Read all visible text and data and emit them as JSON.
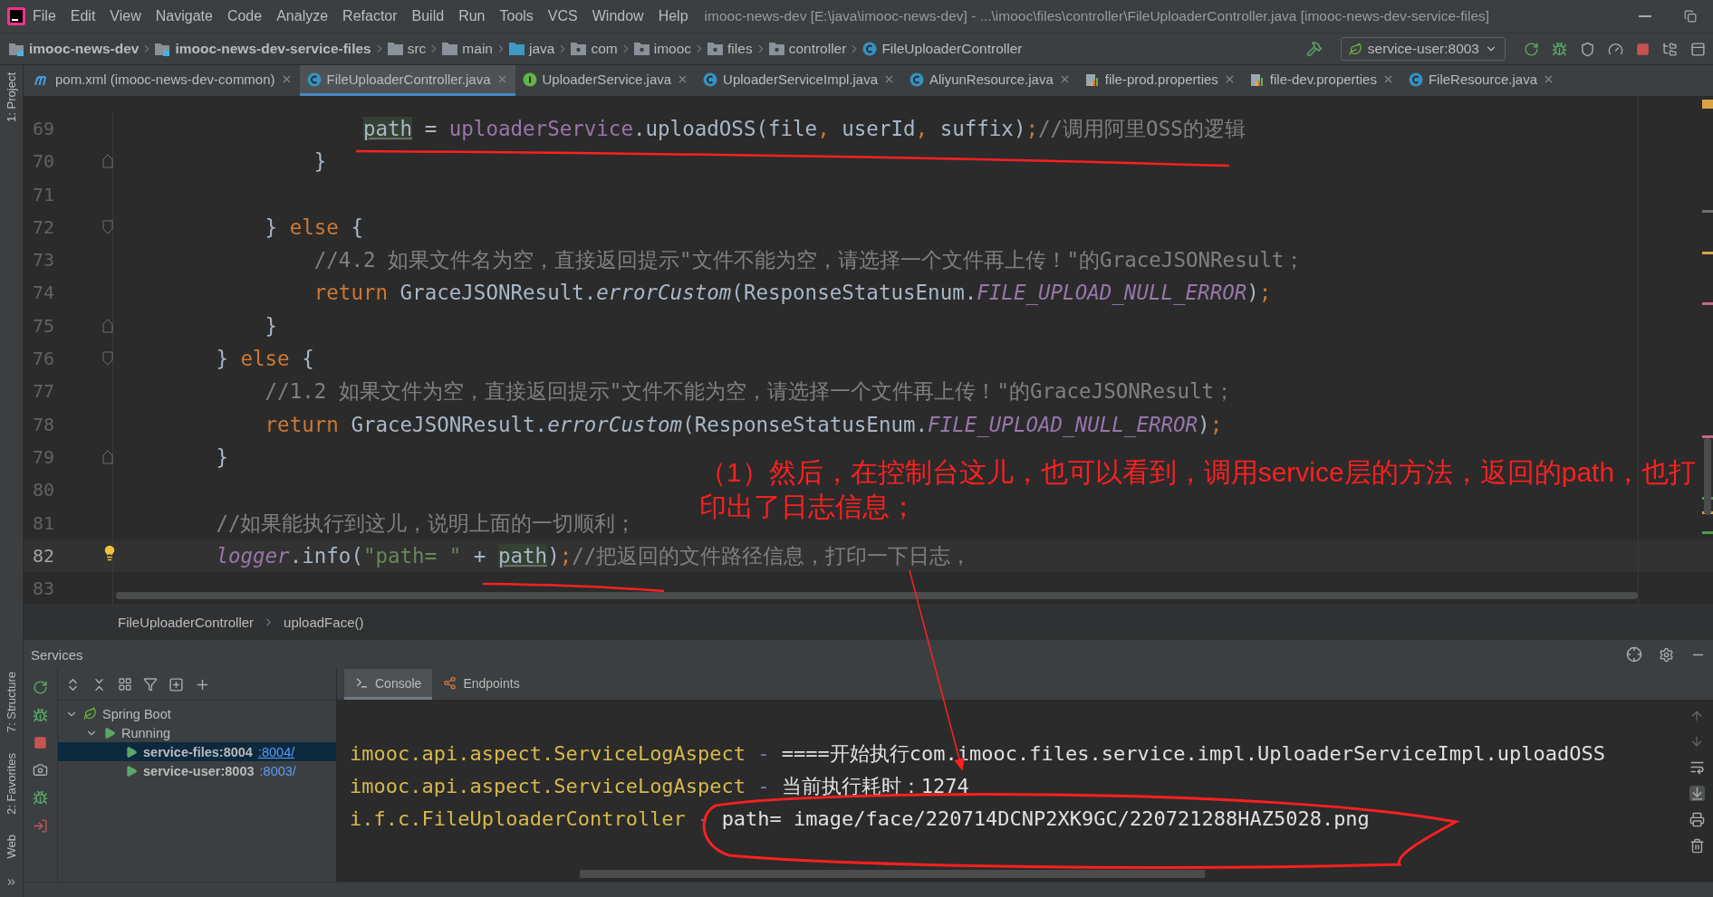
{
  "window": {
    "title": "imooc-news-dev [E:\\java\\imooc-news-dev] - ...\\imooc\\files\\controller\\FileUploaderController.java [imooc-news-dev-service-files]"
  },
  "menu": [
    "File",
    "Edit",
    "View",
    "Navigate",
    "Code",
    "Analyze",
    "Refactor",
    "Build",
    "Run",
    "Tools",
    "VCS",
    "Window",
    "Help"
  ],
  "navigation": [
    {
      "label": "imooc-news-dev",
      "kind": "module"
    },
    {
      "label": "imooc-news-dev-service-files",
      "kind": "module"
    },
    {
      "label": "src",
      "kind": "folder"
    },
    {
      "label": "main",
      "kind": "folder"
    },
    {
      "label": "java",
      "kind": "source"
    },
    {
      "label": "com",
      "kind": "package"
    },
    {
      "label": "imooc",
      "kind": "package"
    },
    {
      "label": "files",
      "kind": "package"
    },
    {
      "label": "controller",
      "kind": "package"
    },
    {
      "label": "FileUploaderController",
      "kind": "class"
    }
  ],
  "run_config": {
    "label": "service-user:8003"
  },
  "tool_strip": [
    {
      "label": "1: Project"
    },
    {
      "label": "7: Structure"
    },
    {
      "label": "2: Favorites"
    },
    {
      "label": "Web"
    }
  ],
  "tabs": [
    {
      "label": "pom.xml (imooc-news-dev-common)",
      "kind": "maven",
      "selected": false
    },
    {
      "label": "FileUploaderController.java",
      "kind": "class",
      "selected": true
    },
    {
      "label": "UploaderService.java",
      "kind": "interface",
      "selected": false
    },
    {
      "label": "UploaderServiceImpl.java",
      "kind": "class",
      "selected": false
    },
    {
      "label": "AliyunResource.java",
      "kind": "class",
      "selected": false
    },
    {
      "label": "file-prod.properties",
      "kind": "properties",
      "selected": false
    },
    {
      "label": "file-dev.properties",
      "kind": "properties",
      "selected": false
    },
    {
      "label": "FileResource.java",
      "kind": "class",
      "selected": false
    }
  ],
  "editor": {
    "lines": [
      {
        "number": "69",
        "current": false,
        "bulb": false,
        "kind": "plain",
        "tokens": [
          {
            "kind": "ref",
            "text": "                    path"
          },
          {
            "kind": "text",
            "text": " = "
          },
          {
            "kind": "field",
            "text": "uploaderService"
          },
          {
            "kind": "text",
            "text": ".uploadOSS(file"
          },
          {
            "kind": "punct",
            "text": ","
          },
          {
            "kind": "text",
            "text": " userId"
          },
          {
            "kind": "punct",
            "text": ","
          },
          {
            "kind": "text",
            "text": " suffix)"
          },
          {
            "kind": "punct",
            "text": ";"
          },
          {
            "kind": "comment",
            "text": "//调用阿里OSS的逻辑"
          }
        ]
      },
      {
        "number": "70",
        "current": false,
        "bulb": false,
        "kind": "fold_end",
        "tokens": [
          {
            "kind": "text",
            "text": "                }"
          }
        ]
      },
      {
        "number": "71",
        "current": false,
        "bulb": false,
        "kind": "plain"
      },
      {
        "number": "72",
        "current": false,
        "bulb": false,
        "kind": "fold_start",
        "tokens": [
          {
            "kind": "text",
            "text": "            } "
          },
          {
            "kind": "keyword",
            "text": "else"
          },
          {
            "kind": "text",
            "text": " {"
          }
        ]
      },
      {
        "number": "73",
        "current": false,
        "bulb": false,
        "kind": "plain",
        "tokens": [
          {
            "kind": "comment",
            "text": "                //4.2 如果文件名为空，直接返回提示\"文件不能为空，请选择一个文件再上传！\"的GraceJSONResult；"
          }
        ]
      },
      {
        "number": "74",
        "current": false,
        "bulb": false,
        "kind": "plain",
        "tokens": [
          {
            "kind": "keyword",
            "text": "                return"
          },
          {
            "kind": "text",
            "text": " GraceJSONResult."
          },
          {
            "kind": "static",
            "text": "errorCustom"
          },
          {
            "kind": "text",
            "text": "(ResponseStatusEnum."
          },
          {
            "kind": "constant",
            "text": "FILE_UPLOAD_NULL_ERROR"
          },
          {
            "kind": "text",
            "text": ")"
          },
          {
            "kind": "punct",
            "text": ";"
          }
        ]
      },
      {
        "number": "75",
        "current": false,
        "bulb": false,
        "kind": "fold_end",
        "tokens": [
          {
            "kind": "text",
            "text": "            }"
          }
        ]
      },
      {
        "number": "76",
        "current": false,
        "bulb": false,
        "kind": "fold_start",
        "tokens": [
          {
            "kind": "text",
            "text": "        } "
          },
          {
            "kind": "keyword",
            "text": "else"
          },
          {
            "kind": "text",
            "text": " {"
          }
        ]
      },
      {
        "number": "77",
        "current": false,
        "bulb": false,
        "kind": "plain",
        "tokens": [
          {
            "kind": "comment",
            "text": "            //1.2 如果文件为空，直接返回提示\"文件不能为空，请选择一个文件再上传！\"的GraceJSONResult；"
          }
        ]
      },
      {
        "number": "78",
        "current": false,
        "bulb": false,
        "kind": "plain",
        "tokens": [
          {
            "kind": "keyword",
            "text": "            return"
          },
          {
            "kind": "text",
            "text": " GraceJSONResult."
          },
          {
            "kind": "static",
            "text": "errorCustom"
          },
          {
            "kind": "text",
            "text": "(ResponseStatusEnum."
          },
          {
            "kind": "constant",
            "text": "FILE_UPLOAD_NULL_ERROR"
          },
          {
            "kind": "text",
            "text": ")"
          },
          {
            "kind": "punct",
            "text": ";"
          }
        ]
      },
      {
        "number": "79",
        "current": false,
        "bulb": false,
        "kind": "fold_end",
        "tokens": [
          {
            "kind": "text",
            "text": "        }"
          }
        ]
      },
      {
        "number": "80",
        "current": false,
        "bulb": false,
        "kind": "plain"
      },
      {
        "number": "81",
        "current": false,
        "bulb": false,
        "kind": "plain",
        "tokens": [
          {
            "kind": "comment",
            "text": "        //如果能执行到这儿，说明上面的一切顺利；"
          }
        ]
      },
      {
        "number": "82",
        "current": true,
        "bulb": true,
        "kind": "plain",
        "tokens": [
          {
            "kind": "logger",
            "text": "        logger"
          },
          {
            "kind": "text",
            "text": ".info("
          },
          {
            "kind": "string",
            "text": "\"path= \""
          },
          {
            "kind": "text",
            "text": " + "
          },
          {
            "kind": "ref",
            "text": "path"
          },
          {
            "kind": "text",
            "text": ")"
          },
          {
            "kind": "punct",
            "text": ";"
          },
          {
            "kind": "comment",
            "text": "//把返回的文件路径信息，打印一下日志，"
          }
        ]
      },
      {
        "number": "83",
        "current": false,
        "bulb": false,
        "kind": "plain"
      }
    ],
    "breadcrumb": [
      "FileUploaderController",
      "uploadFace()"
    ]
  },
  "annotation": {
    "text": "（1）然后，在控制台这儿，也可以看到，调用service层的方法，返回的path，也打印出了日志信息；"
  },
  "services": {
    "title": "Services",
    "tree": [
      {
        "label": "Spring Boot",
        "kind": "spring",
        "expanded": true,
        "selected": false,
        "children": [
          {
            "label": "Running",
            "kind": "status",
            "expanded": true,
            "selected": false,
            "children": [
              {
                "label": "service-files:8004",
                "link": ":8004/",
                "kind": "app",
                "selected": true
              },
              {
                "label": "service-user:8003",
                "link": ":8003/",
                "kind": "app",
                "selected": false
              }
            ]
          }
        ]
      }
    ],
    "console_tabs": [
      {
        "label": "Console",
        "kind": "console",
        "selected": true
      },
      {
        "label": "Endpoints",
        "kind": "endpoints",
        "selected": false
      }
    ],
    "console_lines": [
      {
        "source": "imooc.api.aspect.ServiceLogAspect",
        "separator": "-",
        "message": "====开始执行com.imooc.files.service.impl.UploaderServiceImpl.uploadOSS"
      },
      {
        "source": "imooc.api.aspect.ServiceLogAspect",
        "separator": "-",
        "message": "当前执行耗时：1274"
      },
      {
        "source": "i.f.c.FileUploaderController",
        "separator": "-",
        "message": "path= image/face/220714DCNP2XK9GC/220721288HAZ5028.png"
      }
    ]
  }
}
